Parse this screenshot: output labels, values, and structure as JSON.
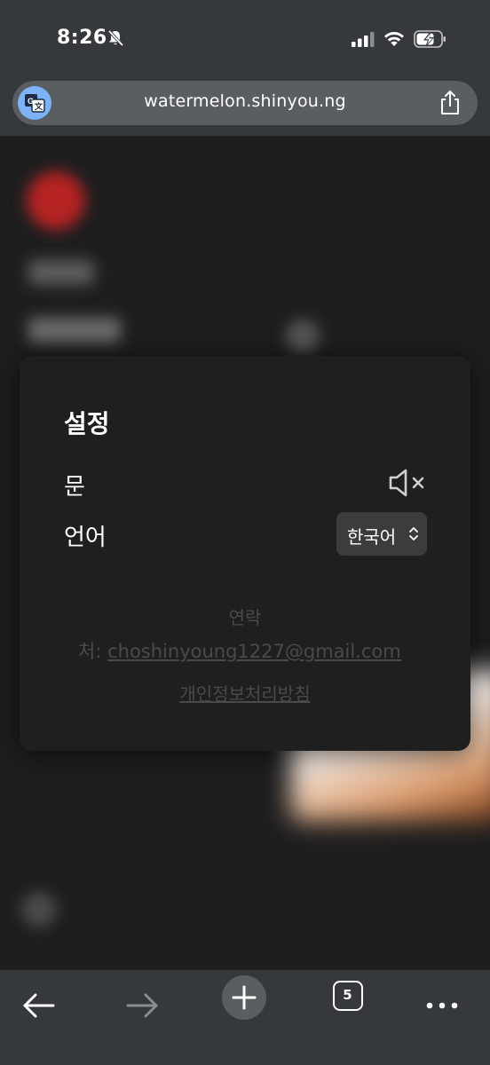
{
  "status_bar": {
    "time": "8:26",
    "icons": [
      "bell-off-icon",
      "signal-icon",
      "wifi-icon",
      "battery-charging-icon"
    ]
  },
  "browser": {
    "url": "watermelon.shinyou.ng",
    "icons": [
      "translate-icon",
      "share-icon"
    ]
  },
  "settings": {
    "title": "설정",
    "sound_label": "문",
    "sound_icon": "speaker-muted-icon",
    "language_label": "언어",
    "language_value": "한국어",
    "contact_label": "연락",
    "contact_prefix": "처:",
    "contact_email": "choshinyoung1227@gmail.com",
    "privacy_link": "개인정보처리방침"
  },
  "toolbar": {
    "tab_count": "5",
    "icons": [
      "back-arrow-icon",
      "forward-arrow-icon",
      "plus-icon",
      "tabs-icon",
      "more-icon"
    ]
  },
  "colors": {
    "chrome_bg": "#35393c",
    "url_pill": "#595e61",
    "modal_bg": "#1f1f1f",
    "select_bg": "#3c3c3c",
    "muted_text": "#4a4a4a",
    "translate_blue": "#7db2f7"
  }
}
